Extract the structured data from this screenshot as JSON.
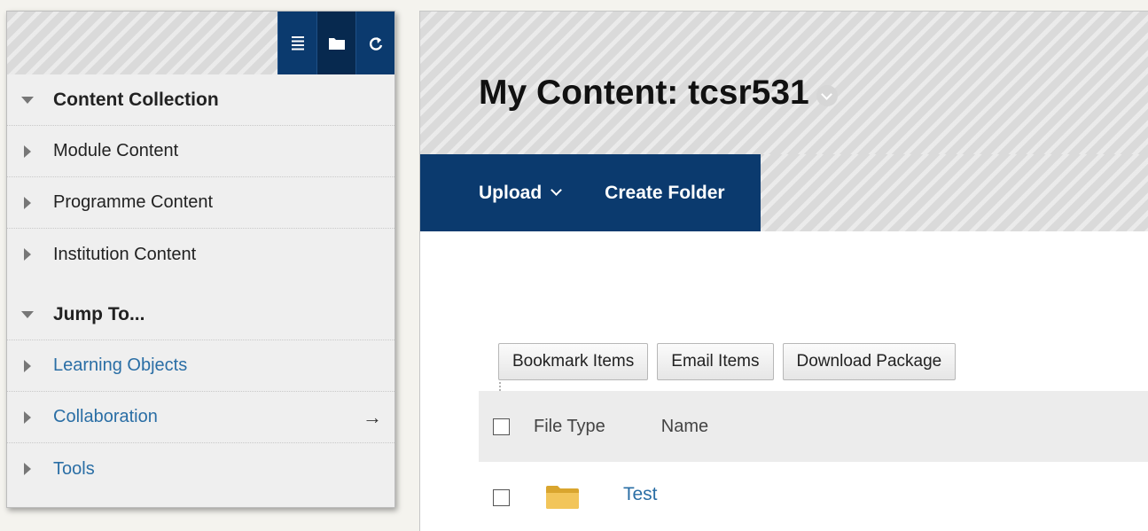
{
  "panel": {
    "toolbar": [
      {
        "icon": "list-icon"
      },
      {
        "icon": "folder-icon"
      },
      {
        "icon": "refresh-icon"
      }
    ],
    "sections": {
      "content_collection": "Content Collection",
      "module_content": "Module Content",
      "programme_content": "Programme Content",
      "institution_content": "Institution Content",
      "jump_to": "Jump To...",
      "learning_objects": "Learning Objects",
      "collaboration": "Collaboration",
      "collaboration_arrow": "→",
      "tools": "Tools"
    }
  },
  "main": {
    "title": "My Content: tcsr531",
    "actions": {
      "upload": "Upload",
      "create_folder": "Create Folder"
    },
    "bulk": {
      "bookmark": "Bookmark Items",
      "email": "Email Items",
      "download": "Download Package"
    },
    "table": {
      "columns": {
        "file_type": "File Type",
        "name": "Name"
      },
      "rows": [
        {
          "name": "Test",
          "icon": "folder-icon"
        }
      ]
    }
  },
  "colors": {
    "navy": "#0b3a6e",
    "link": "#2a6ea5",
    "folder": "#e9b93b"
  }
}
